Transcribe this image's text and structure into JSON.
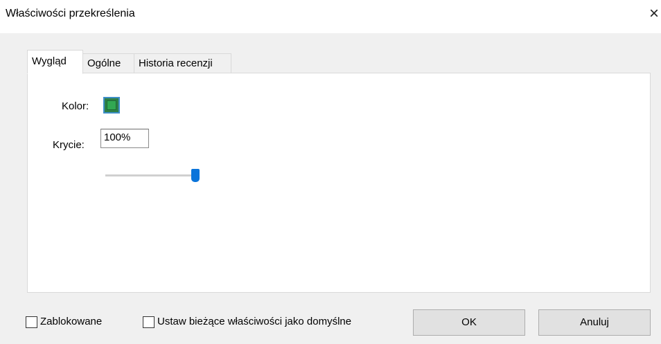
{
  "dialog": {
    "title": "Właściwości przekreślenia",
    "close_glyph": "×"
  },
  "tabs": [
    {
      "label": "Wygląd",
      "active": true
    },
    {
      "label": "Ogólne",
      "active": false
    },
    {
      "label": "Historia recenzji",
      "active": false
    }
  ],
  "appearance": {
    "color_label": "Kolor:",
    "color_value": "#32a852",
    "opacity_label": "Krycie:",
    "opacity_value": "100%",
    "opacity_level": 1.0
  },
  "footer": {
    "locked_label": "Zablokowane",
    "locked_checked": false,
    "default_label": "Ustaw bieżące właściwości jako domyślne",
    "default_checked": false,
    "ok_label": "OK",
    "cancel_label": "Anuluj"
  },
  "colors": {
    "accent": "#0a74da",
    "window_bg": "#f0f0f0",
    "panel_bg": "#ffffff"
  }
}
